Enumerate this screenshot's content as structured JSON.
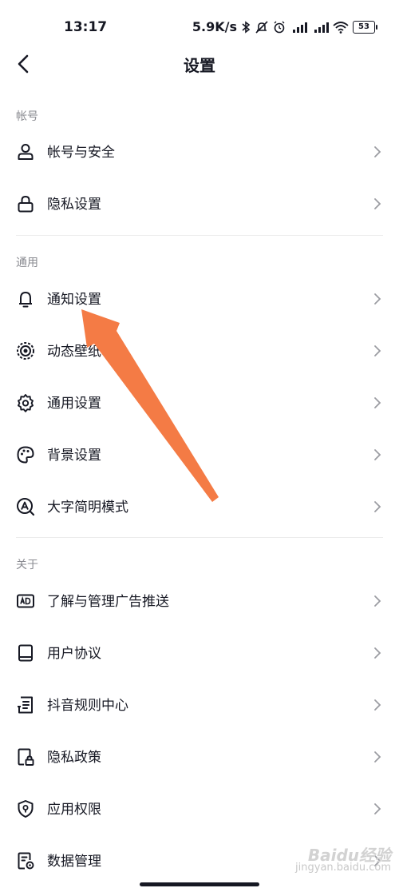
{
  "status": {
    "time": "13:17",
    "speed": "5.9K/s",
    "battery": "53"
  },
  "header": {
    "title": "设置"
  },
  "sections": {
    "account": {
      "label": "帐号",
      "items": [
        {
          "label": "帐号与安全",
          "icon": "person-icon"
        },
        {
          "label": "隐私设置",
          "icon": "lock-icon"
        }
      ]
    },
    "general": {
      "label": "通用",
      "items": [
        {
          "label": "通知设置",
          "icon": "bell-icon"
        },
        {
          "label": "动态壁纸",
          "icon": "live-wallpaper-icon"
        },
        {
          "label": "通用设置",
          "icon": "gear-icon"
        },
        {
          "label": "背景设置",
          "icon": "palette-icon"
        },
        {
          "label": "大字简明模式",
          "icon": "large-font-icon"
        }
      ]
    },
    "about": {
      "label": "关于",
      "items": [
        {
          "label": "了解与管理广告推送",
          "icon": "ad-icon"
        },
        {
          "label": "用户协议",
          "icon": "book-icon"
        },
        {
          "label": "抖音规则中心",
          "icon": "document-list-icon"
        },
        {
          "label": "隐私政策",
          "icon": "privacy-doc-icon"
        },
        {
          "label": "应用权限",
          "icon": "shield-icon"
        },
        {
          "label": "数据管理",
          "icon": "data-manage-icon"
        }
      ]
    }
  },
  "watermark": {
    "main": "Baidu经验",
    "sub": "jingyan.baidu.com"
  },
  "colors": {
    "text": "#161823",
    "section_label": "#8a8b91",
    "annotation_arrow": "#f47b45"
  }
}
